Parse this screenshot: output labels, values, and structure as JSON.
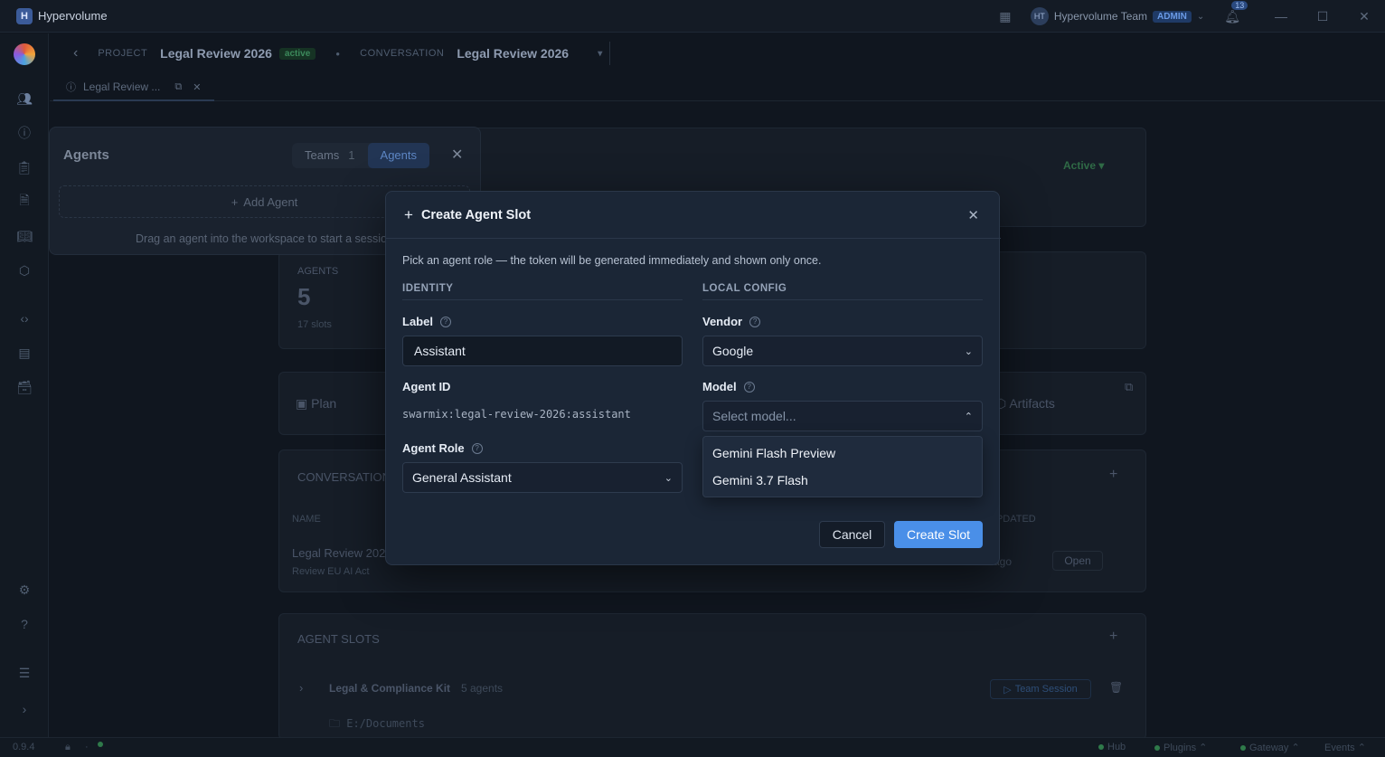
{
  "app": {
    "logo_letter": "H",
    "title": "Hypervolume"
  },
  "titlebar": {
    "user_initials": "HT",
    "user_name": "Hypervolume Team",
    "role_badge": "ADMIN",
    "notification_count": "13"
  },
  "header": {
    "project_label": "PROJECT",
    "project_name": "Legal Review 2026",
    "project_status": "active",
    "conversation_label": "CONVERSATION",
    "conversation_name": "Legal Review 2026"
  },
  "tabs": [
    {
      "label": "Legal Review ..."
    }
  ],
  "background": {
    "status_select": "Active",
    "agents_stat_label": "AGENTS",
    "agents_stat_value": "5",
    "agents_stat_sub": "17 slots",
    "plan_label": "Plan",
    "artifacts_label": "Artifacts",
    "conversations_title": "CONVERSATIONS",
    "col_name": "NAME",
    "col_updated": "UPDATED",
    "row_title": "Legal Review 2026",
    "row_subtitle": "Review EU AI Act",
    "row_updated": "ago",
    "row_open": "Open",
    "agent_slots_title": "AGENT SLOTS",
    "kit_name": "Legal & Compliance Kit",
    "kit_count": "5 agents",
    "team_session": "Team Session",
    "kit_path": "E:/Documents"
  },
  "agents_panel": {
    "title": "Agents",
    "teams_tab": "Teams",
    "teams_count": "1",
    "agents_tab": "Agents",
    "add_agent": "Add Agent",
    "hint": "Drag an agent into the workspace to start a session"
  },
  "modal": {
    "title": "Create Agent Slot",
    "description": "Pick an agent role — the token will be generated immediately and shown only once.",
    "identity_section": "IDENTITY",
    "local_config_section": "LOCAL CONFIG",
    "label_field": "Label",
    "label_value": "Assistant",
    "agent_id_label": "Agent ID",
    "agent_id_value": "swarmix:legal-review-2026:assistant",
    "agent_role_label": "Agent Role",
    "agent_role_value": "General Assistant",
    "vendor_label": "Vendor",
    "vendor_value": "Google",
    "model_label": "Model",
    "model_placeholder": "Select model...",
    "model_options": [
      "Gemini Flash Preview",
      "Gemini 3.7 Flash"
    ],
    "cancel": "Cancel",
    "create": "Create Slot"
  },
  "statusbar": {
    "version": "0.9.4",
    "hub": "Hub",
    "plugins": "Plugins",
    "gateway": "Gateway",
    "events": "Events"
  }
}
